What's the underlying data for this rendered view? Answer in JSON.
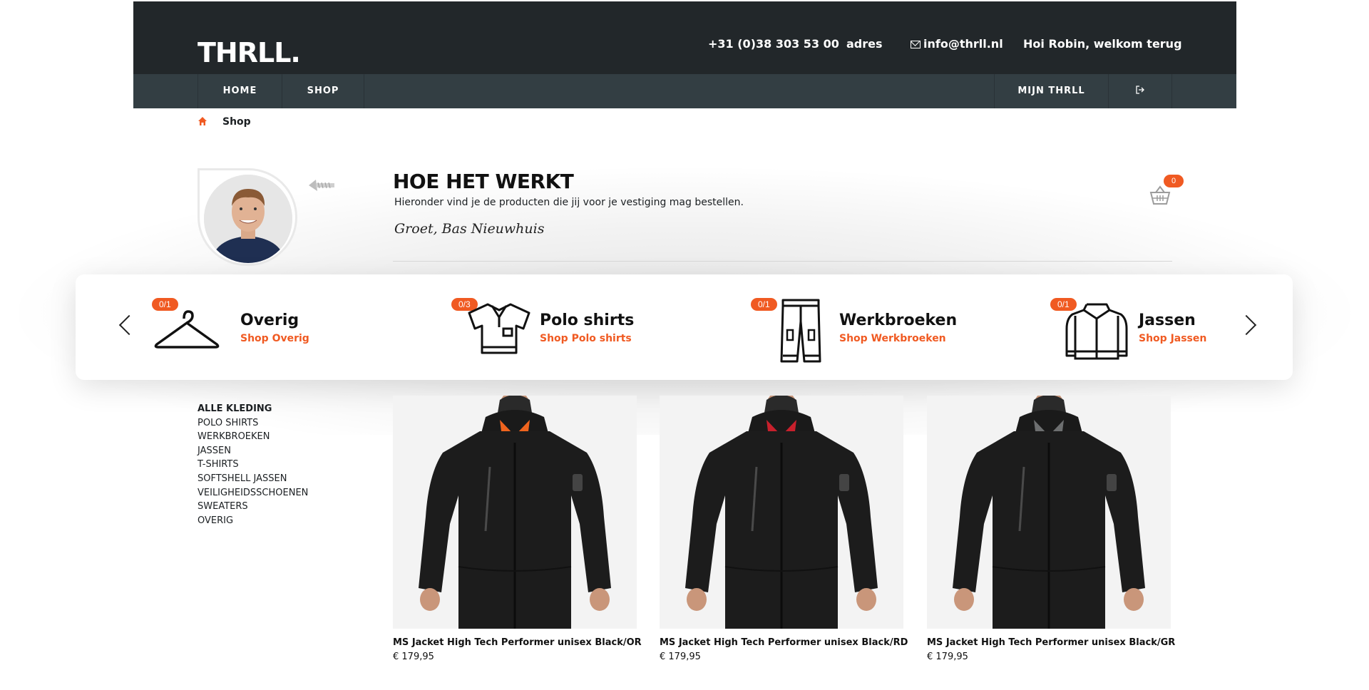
{
  "header": {
    "logo": "THRLL.",
    "phone": "+31 (0)38 303 53 00",
    "address": "adres",
    "email": "info@thrll.nl",
    "greeting": "Hoi Robin, welkom terug"
  },
  "nav": {
    "home": "HOME",
    "shop": "SHOP",
    "account": "MIJN THRLL",
    "logout_icon": "logout-icon"
  },
  "breadcrumb": {
    "home_icon": "home-icon",
    "current": "Shop"
  },
  "hero": {
    "title": "HOE HET WERKT",
    "subtitle": "Hieronder vind je de producten die jij voor je vestiging mag bestellen.",
    "signature": "Groet, Bas Nieuwhuis",
    "cart_count": "0"
  },
  "categories": [
    {
      "badge": "0/1",
      "name": "Overig",
      "link": "Shop Overig",
      "icon": "hanger-icon"
    },
    {
      "badge": "0/3",
      "name": "Polo shirts",
      "link": "Shop Polo shirts",
      "icon": "polo-shirt-icon"
    },
    {
      "badge": "0/1",
      "name": "Werkbroeken",
      "link": "Shop Werkbroeken",
      "icon": "trousers-icon"
    },
    {
      "badge": "0/1",
      "name": "Jassen",
      "link": "Shop Jassen",
      "icon": "jacket-icon"
    }
  ],
  "sidebar": {
    "items": [
      "ALLE KLEDING",
      "POLO SHIRTS",
      "WERKBROEKEN",
      "JASSEN",
      "T-SHIRTS",
      "SOFTSHELL JASSEN",
      "VEILIGHEIDSSCHOENEN",
      "SWEATERS",
      "OVERIG"
    ]
  },
  "products": [
    {
      "name": "MS Jacket High Tech Performer unisex Black/OR",
      "price": "€ 179,95",
      "accent": "#f0641e"
    },
    {
      "name": "MS Jacket High Tech Performer unisex Black/RD",
      "price": "€ 179,95",
      "accent": "#c8202c"
    },
    {
      "name": "MS Jacket High Tech Performer unisex Black/GR",
      "price": "€ 179,95",
      "accent": "#6d6f70"
    }
  ],
  "colors": {
    "header_bg": "#22272a",
    "nav_bg": "#333e43",
    "accent": "#f05a22"
  }
}
